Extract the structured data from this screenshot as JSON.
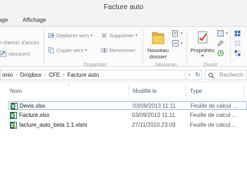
{
  "window": {
    "title": "Facture auto"
  },
  "tabs": [
    {
      "label": "age"
    },
    {
      "label": "Affichage"
    }
  ],
  "ribbon": {
    "left_items": [
      "e chemin d'accès",
      "raccourci"
    ],
    "organize": {
      "move_to": "Déplacer vers",
      "copy_to": "Copier vers",
      "delete": "Supprimer",
      "rename": "Renommer",
      "group_label": "Organiser"
    },
    "new": {
      "new_folder_line1": "Nouveau",
      "new_folder_line2": "dossier",
      "group_label": "Nouveau"
    },
    "open": {
      "properties": "Propriétés",
      "group_label": "Ouvrir"
    }
  },
  "address": {
    "crumbs": [
      "onio",
      "Dropbox",
      "CFE",
      "Facture auto"
    ],
    "search_placeholder": "Recherch"
  },
  "columns": {
    "name": "Nom",
    "modified": "Modifié le",
    "type": "Type"
  },
  "files": [
    {
      "name": "Devis.xlsx",
      "modified": "03/09/2013 11:11",
      "type": "Feuille de calcul ...",
      "selected": true
    },
    {
      "name": "Facture.xlsx",
      "modified": "03/09/2013 11:11",
      "type": "Feuille de calcul ...",
      "selected": false
    },
    {
      "name": "facture_auto_beta 1.1.xlsm",
      "modified": "27/11/2010 23:09",
      "type": "Feuille de calcul ...",
      "selected": false
    }
  ],
  "colors": {
    "accent": "#3a6ea5",
    "excel_green": "#1e7145",
    "folder_yellow": "#e8b73c"
  }
}
